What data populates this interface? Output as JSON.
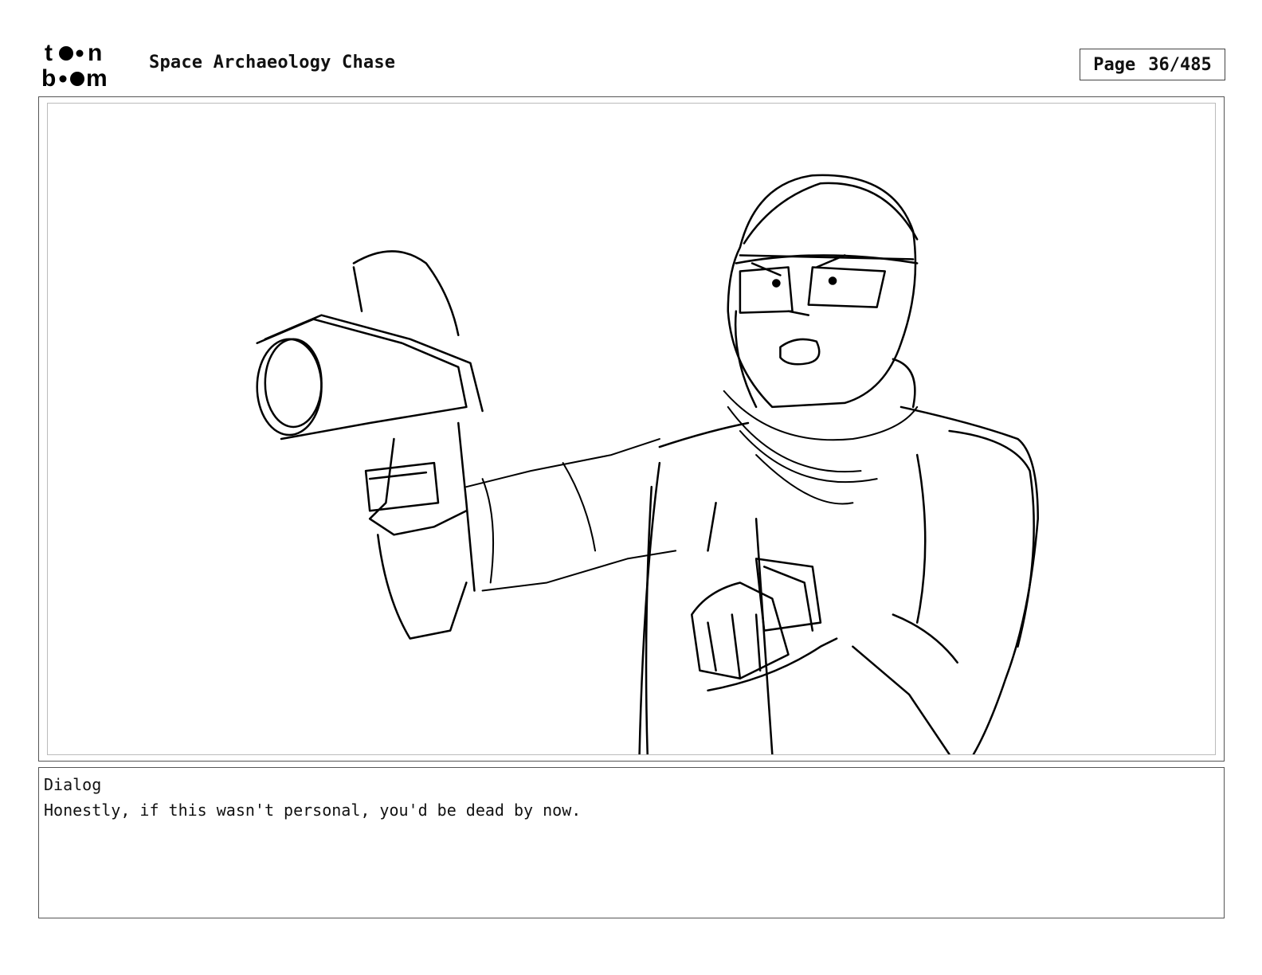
{
  "header": {
    "logo_line1": "toon",
    "logo_line2": "boom",
    "title": "Space Archaeology Chase",
    "page_label": "Page",
    "page_value": "36/485"
  },
  "panel": {
    "image_icon": "storyboard-sketch-icon"
  },
  "dialog": {
    "label": "Dialog",
    "text": "Honestly, if this wasn't personal, you'd be dead by now."
  }
}
